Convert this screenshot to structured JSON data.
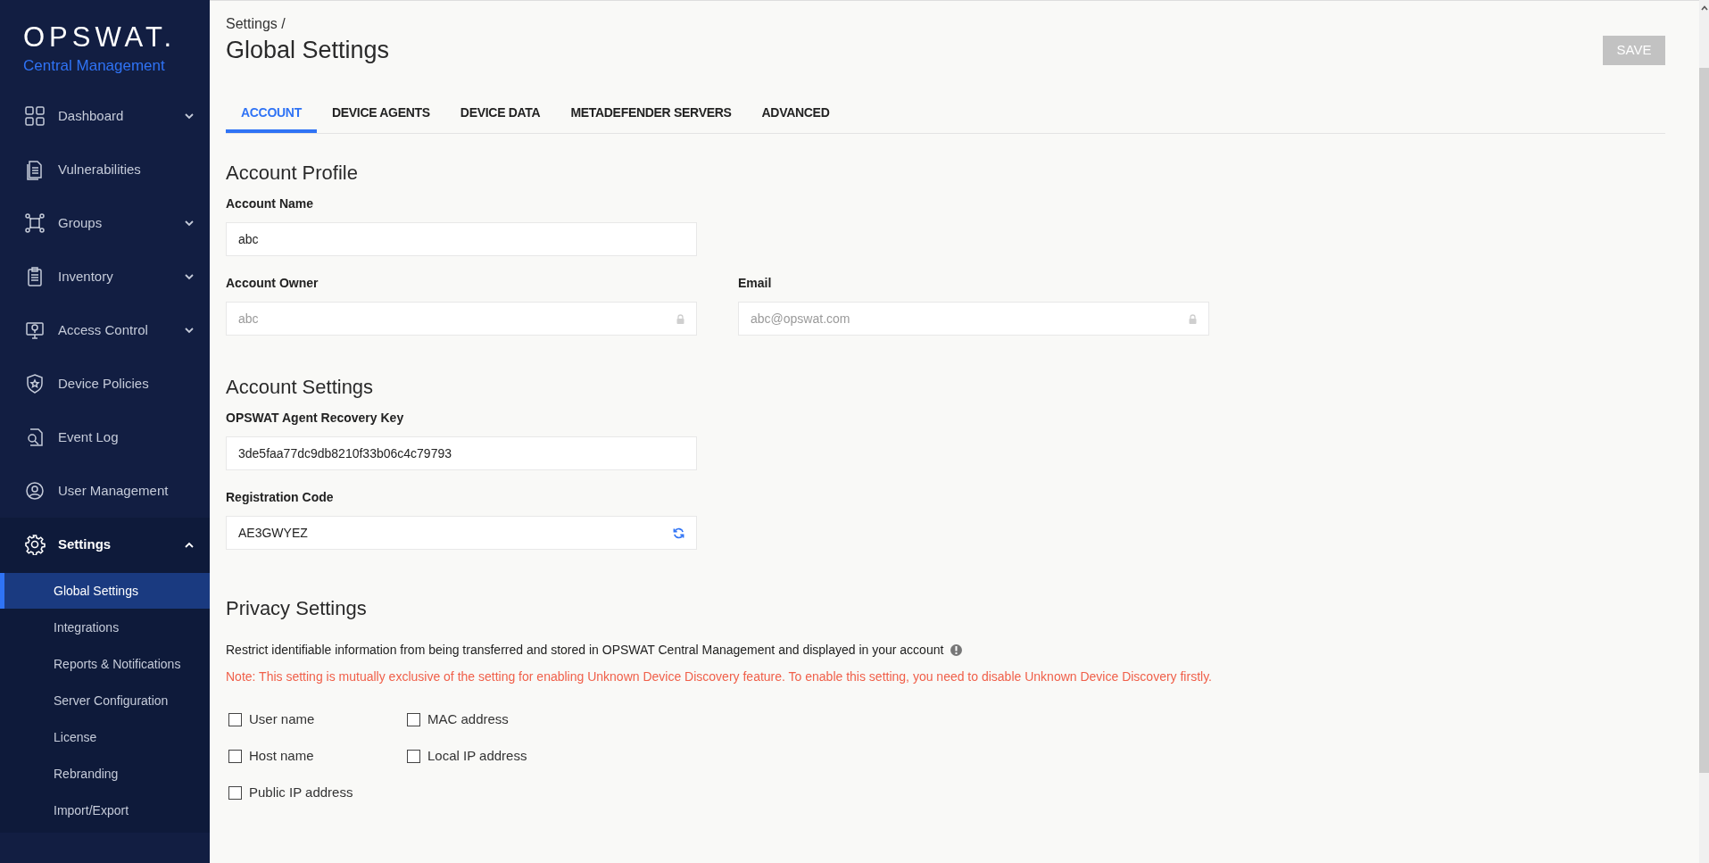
{
  "sidebar": {
    "brand": "OPSWAT.",
    "subtitle": "Central Management",
    "items": [
      {
        "label": "Dashboard",
        "kind": "group",
        "expanded": false,
        "selected": false
      },
      {
        "label": "Vulnerabilities",
        "kind": "link",
        "selected": false
      },
      {
        "label": "Groups",
        "kind": "group",
        "expanded": false,
        "selected": false
      },
      {
        "label": "Inventory",
        "kind": "group",
        "expanded": false,
        "selected": false
      },
      {
        "label": "Access Control",
        "kind": "group",
        "expanded": false,
        "selected": false
      },
      {
        "label": "Device Policies",
        "kind": "link",
        "selected": false
      },
      {
        "label": "Event Log",
        "kind": "link",
        "selected": false
      },
      {
        "label": "User Management",
        "kind": "link",
        "selected": false
      },
      {
        "label": "Settings",
        "kind": "group",
        "expanded": true,
        "selected": true,
        "children": [
          {
            "label": "Global Settings",
            "selected": true
          },
          {
            "label": "Integrations",
            "selected": false
          },
          {
            "label": "Reports & Notifications",
            "selected": false
          },
          {
            "label": "Server Configuration",
            "selected": false
          },
          {
            "label": "License",
            "selected": false
          },
          {
            "label": "Rebranding",
            "selected": false
          },
          {
            "label": "Import/Export",
            "selected": false
          }
        ]
      }
    ]
  },
  "breadcrumb": "Settings /",
  "title": "Global Settings",
  "save_button": {
    "label": "SAVE",
    "disabled": true
  },
  "tabs": [
    {
      "label": "ACCOUNT",
      "selected": true
    },
    {
      "label": "DEVICE AGENTS",
      "selected": false
    },
    {
      "label": "DEVICE DATA",
      "selected": false
    },
    {
      "label": "METADEFENDER SERVERS",
      "selected": false
    },
    {
      "label": "ADVANCED",
      "selected": false
    }
  ],
  "account_profile": {
    "heading": "Account Profile",
    "rows": [
      [
        {
          "label": "Account Name",
          "value": "abc",
          "kind": "text"
        }
      ],
      [
        {
          "label": "Account Owner",
          "value": "abc",
          "kind": "locked"
        },
        {
          "label": "Email",
          "value": "abc@opswat.com",
          "kind": "locked"
        }
      ]
    ]
  },
  "account_settings": {
    "heading": "Account Settings",
    "rows": [
      [
        {
          "label": "OPSWAT Agent Recovery Key",
          "value": "3de5faa77dc9db8210f33b06c4c79793",
          "kind": "text"
        }
      ],
      [
        {
          "label": "Registration Code",
          "value": "AE3GWYEZ",
          "kind": "refresh"
        }
      ]
    ]
  },
  "privacy_settings": {
    "heading": "Privacy Settings",
    "description": "Restrict identifiable information from being transferred and stored in OPSWAT Central Management and displayed in your account",
    "note": "Note: This setting is mutually exclusive of the setting for enabling Unknown Device Discovery feature. To enable this setting, you need to disable Unknown Device Discovery firstly.",
    "checkboxes": [
      {
        "label": "User name",
        "checked": false
      },
      {
        "label": "MAC address",
        "checked": false
      },
      {
        "label": "Host name",
        "checked": false
      },
      {
        "label": "Local IP address",
        "checked": false
      },
      {
        "label": "Public IP address",
        "checked": false
      }
    ]
  }
}
